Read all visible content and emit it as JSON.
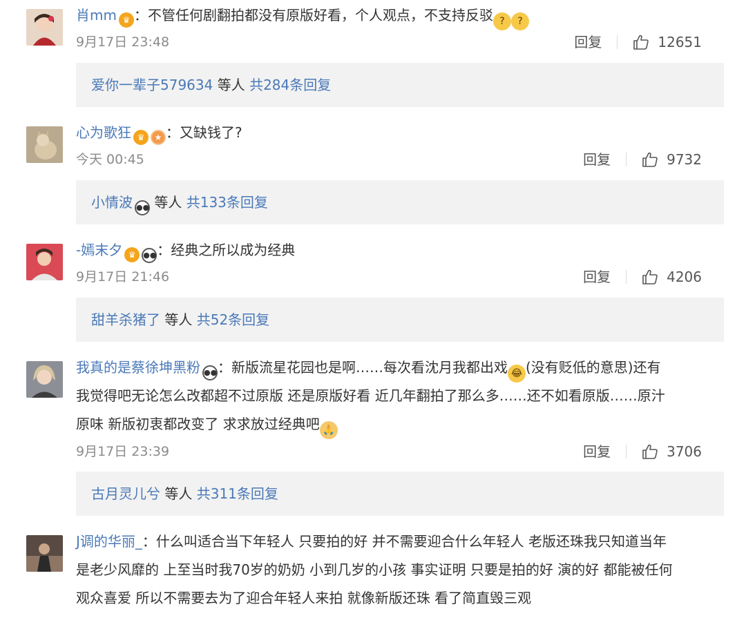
{
  "comments": [
    {
      "username": "肖mm",
      "badges": [
        "vip-crown"
      ],
      "text": "：不管任何剧翻拍都没有原版好看，个人观点，不支持反驳",
      "emojis": [
        "thinking-emoji",
        "thinking-emoji"
      ],
      "date": "9月17日 23:48",
      "reply_label": "回复",
      "likes": "12651",
      "replies_from": "爱你一辈子579634",
      "replies_mid": " 等人 ",
      "replies_total": "共284条回复"
    },
    {
      "username": "心为歌狂",
      "badges": [
        "vip-crown",
        "level-medal"
      ],
      "text": "：又缺钱了?",
      "date": "今天 00:45",
      "reply_label": "回复",
      "likes": "9732",
      "replies_from": "小情波",
      "replies_mid": " 等人 ",
      "replies_total": "共133条回复"
    },
    {
      "username": "-嫣末夕",
      "badges": [
        "vip-crown",
        "panda"
      ],
      "text": "：经典之所以成为经典",
      "date": "9月17日 21:46",
      "reply_label": "回复",
      "likes": "4206",
      "replies_from": "甜羊杀猪了",
      "replies_mid": " 等人 ",
      "replies_total": "共52条回复"
    },
    {
      "username": "我真的是蔡徐坤黑粉",
      "badges": [
        "panda"
      ],
      "text_line1": "：新版流星花园也是啊……每次看沈月我都出戏",
      "text_line1b": "(没有贬低的意思)还有",
      "text_line2": "我觉得吧无论怎么改都超不过原版 还是原版好看 近几年翻拍了那么多……还不如看原版……原汁",
      "text_line3": "原味 新版初衷都改变了 求求放过经典吧",
      "date": "9月17日 23:39",
      "reply_label": "回复",
      "likes": "3706",
      "replies_from": "古月灵儿兮",
      "replies_mid": " 等人 ",
      "replies_total": "共311条回复"
    },
    {
      "username": "J调的华丽_",
      "text_line1": "：什么叫适合当下年轻人 只要拍的好 并不需要迎合什么年轻人 老版还珠我只知道当年",
      "text_line2": "是老少风靡的 上至当时我70岁的奶奶 小到几岁的小孩 事实证明 只要是拍的好 演的好 都能被任何",
      "text_line3": "观众喜爱 所以不需要去为了迎合年轻人来拍 就像新版还珠 看了简直毁三观"
    }
  ],
  "colors": {
    "username": "#4a79b8",
    "meta": "#8b8b8b",
    "reply_bg": "#f2f2f2"
  }
}
